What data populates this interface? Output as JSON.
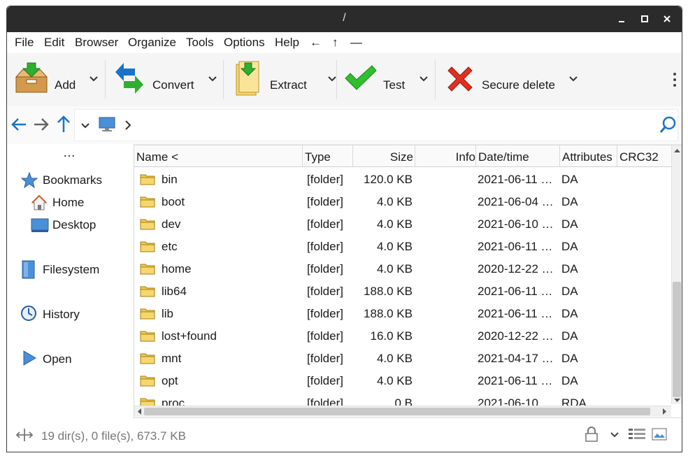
{
  "window": {
    "title": "/"
  },
  "menu": [
    "File",
    "Edit",
    "Browser",
    "Organize",
    "Tools",
    "Options",
    "Help",
    "←",
    "↑",
    "—"
  ],
  "toolbar": {
    "add": "Add",
    "convert": "Convert",
    "extract": "Extract",
    "test": "Test",
    "secure_delete": "Secure delete"
  },
  "sidebar": {
    "more": "…",
    "bookmarks": "Bookmarks",
    "home": "Home",
    "desktop": "Desktop",
    "filesystem": "Filesystem",
    "history": "History",
    "open": "Open"
  },
  "columns": [
    "Name <",
    "Type",
    "Size",
    "Info",
    "Date/time",
    "Attributes",
    "CRC32"
  ],
  "rows": [
    {
      "name": "bin",
      "type": "[folder]",
      "size": "120.0 KB",
      "date": "2021-06-11 …",
      "attr": "DA"
    },
    {
      "name": "boot",
      "type": "[folder]",
      "size": "4.0 KB",
      "date": "2021-06-04 …",
      "attr": "DA"
    },
    {
      "name": "dev",
      "type": "[folder]",
      "size": "4.0 KB",
      "date": "2021-06-10 …",
      "attr": "DA"
    },
    {
      "name": "etc",
      "type": "[folder]",
      "size": "4.0 KB",
      "date": "2021-06-11 …",
      "attr": "DA"
    },
    {
      "name": "home",
      "type": "[folder]",
      "size": "4.0 KB",
      "date": "2020-12-22 …",
      "attr": "DA"
    },
    {
      "name": "lib64",
      "type": "[folder]",
      "size": "188.0 KB",
      "date": "2021-06-11 …",
      "attr": "DA"
    },
    {
      "name": "lib",
      "type": "[folder]",
      "size": "188.0 KB",
      "date": "2021-06-11 …",
      "attr": "DA"
    },
    {
      "name": "lost+found",
      "type": "[folder]",
      "size": "16.0 KB",
      "date": "2020-12-22 …",
      "attr": "DA"
    },
    {
      "name": "mnt",
      "type": "[folder]",
      "size": "4.0 KB",
      "date": "2021-04-17 …",
      "attr": "DA"
    },
    {
      "name": "opt",
      "type": "[folder]",
      "size": "4.0 KB",
      "date": "2021-06-11 …",
      "attr": "DA"
    },
    {
      "name": "proc",
      "type": "[folder]",
      "size": "0 B",
      "date": "2021-06-10 …",
      "attr": "RDA"
    }
  ],
  "status": {
    "text": "19 dir(s), 0 file(s), 673.7 KB"
  },
  "colors": {
    "accent": "#1a73c8",
    "titlebar": "#2b2b2b",
    "folder": "#f2c94c"
  }
}
